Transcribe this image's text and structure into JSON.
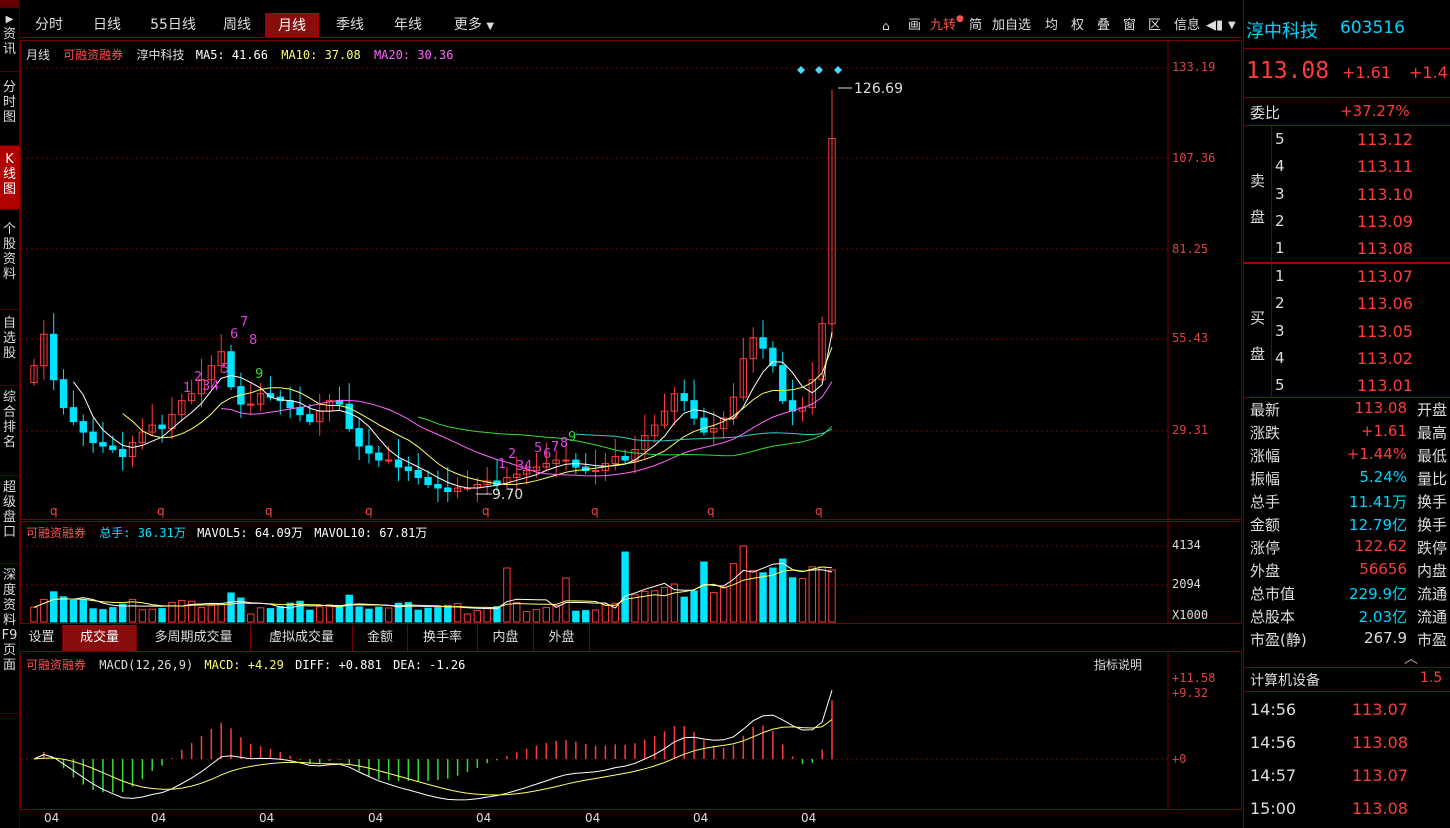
{
  "left_tabs": [
    "资讯",
    "分时图",
    "K线图",
    "个股资料",
    "自选股",
    "综合排名",
    "超级盘口",
    "深度资料F9页面"
  ],
  "periods": [
    "分时",
    "日线",
    "55日线",
    "周线",
    "月线",
    "季线",
    "年线",
    "更多"
  ],
  "tools": [
    "画",
    "九转",
    "简",
    "加自选",
    "均",
    "权",
    "叠",
    "窗",
    "区",
    "信息"
  ],
  "kline": {
    "title": {
      "period": "月线",
      "source": "可融资融券",
      "name": "淳中科技",
      "ma5": "MA5: 41.66",
      "ma10": "MA10: 37.08",
      "ma20": "MA20: 30.36"
    },
    "y_labels": [
      "133.19",
      "107.36",
      "81.25",
      "55.43",
      "29.31"
    ],
    "high_label": "126.69",
    "low_label": "9.70",
    "q_marks": [
      "q",
      "q",
      "q",
      "q",
      "q",
      "q",
      "q",
      "q"
    ],
    "seq9": [
      "1",
      "2",
      "3",
      "4",
      "5",
      "6",
      "7",
      "8",
      "9"
    ],
    "seq9b": [
      "1",
      "2",
      "3",
      "4",
      "5",
      "6",
      "7",
      "8",
      "9"
    ]
  },
  "volume": {
    "source": "可融资融券",
    "total": "总手: 36.31万",
    "mavol5": "MAVOL5: 64.09万",
    "mavol10": "MAVOL10: 67.81万",
    "y_labels": [
      "4134",
      "2094",
      "X1000"
    ]
  },
  "subtabs": [
    "设置",
    "成交量",
    "多周期成交量",
    "虚拟成交量",
    "金额",
    "换手率",
    "内盘",
    "外盘"
  ],
  "macd": {
    "source": "可融资融券",
    "params": "MACD(12,26,9)",
    "macd": "MACD: +4.29",
    "diff": "DIFF: +0.881",
    "dea": "DEA: -1.26",
    "help": "指标说明",
    "y_labels": [
      "+11.58",
      "+9.32",
      "+0"
    ]
  },
  "x_labels": [
    "04",
    "04",
    "04",
    "04",
    "04",
    "04",
    "04",
    "04"
  ],
  "quote": {
    "name": "淳中科技",
    "code": "603516",
    "price": "113.08",
    "change": "+1.61",
    "pct_cut": "+1.4",
    "webi_label": "委比",
    "webi": "+37.27%"
  },
  "sell": {
    "label": "卖盘",
    "levels": [
      [
        "5",
        "113.12"
      ],
      [
        "4",
        "113.11"
      ],
      [
        "3",
        "113.10"
      ],
      [
        "2",
        "113.09"
      ],
      [
        "1",
        "113.08"
      ]
    ]
  },
  "buy": {
    "label": "买盘",
    "levels": [
      [
        "1",
        "113.07"
      ],
      [
        "2",
        "113.06"
      ],
      [
        "3",
        "113.05"
      ],
      [
        "4",
        "113.02"
      ],
      [
        "5",
        "113.01"
      ]
    ]
  },
  "stats": [
    [
      "最新",
      "113.08",
      "开盘"
    ],
    [
      "涨跌",
      "+1.61",
      "最高"
    ],
    [
      "涨幅",
      "+1.44%",
      "最低"
    ],
    [
      "振幅",
      "5.24%",
      "量比"
    ],
    [
      "总手",
      "11.41万",
      "换手"
    ],
    [
      "金额",
      "12.79亿",
      "换手"
    ],
    [
      "涨停",
      "122.62",
      "跌停"
    ],
    [
      "外盘",
      "56656",
      "内盘"
    ],
    [
      "总市值",
      "229.9亿",
      "流通"
    ],
    [
      "总股本",
      "2.03亿",
      "流通"
    ],
    [
      "市盈(静)",
      "267.9",
      "市盈"
    ]
  ],
  "industry": {
    "name": "计算机设备",
    "value": "1.5"
  },
  "ticks": [
    [
      "14:56",
      "113.07"
    ],
    [
      "14:56",
      "113.08"
    ],
    [
      "14:57",
      "113.07"
    ],
    [
      "15:00",
      "113.08"
    ]
  ],
  "colors": {
    "up": "#ff3b3b",
    "down": "#00e5ff",
    "ma5": "#ffffff",
    "ma10": "#ffff66",
    "ma20": "#ff66ff",
    "ma60": "#33dd33",
    "ma120": "#33cccc",
    "grid": "#7a0000"
  }
}
